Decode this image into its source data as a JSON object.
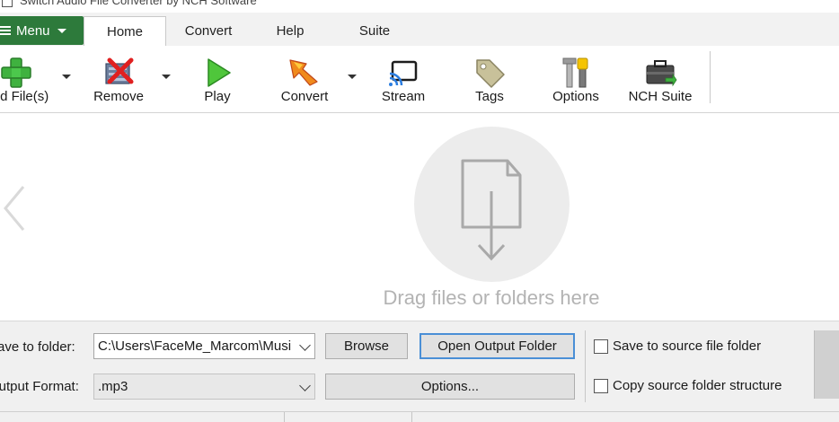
{
  "window": {
    "title": "Switch Audio File Converter by NCH Software"
  },
  "menu": {
    "label": "Menu"
  },
  "tabs": [
    {
      "label": "Home",
      "active": true
    },
    {
      "label": "Convert",
      "active": false
    },
    {
      "label": "Help",
      "active": false
    },
    {
      "label": "Suite",
      "active": false
    }
  ],
  "ribbon": {
    "add_files": "Add File(s)",
    "remove": "Remove",
    "play": "Play",
    "convert": "Convert",
    "stream": "Stream",
    "tags": "Tags",
    "options": "Options",
    "nch_suite": "NCH Suite"
  },
  "dropzone": {
    "text": "Drag files or folders here"
  },
  "output": {
    "save_to_folder_label": "Save to folder:",
    "folder_value": "C:\\Users\\FaceMe_Marcom\\Music",
    "browse": "Browse",
    "open_output_folder": "Open Output Folder",
    "output_format_label": "Output Format:",
    "format_value": ".mp3",
    "options": "Options...",
    "save_to_source": "Save to source file folder",
    "copy_structure": "Copy source folder structure"
  },
  "colors": {
    "menu_green": "#2d7a3b",
    "accent_blue": "#4a8fd6"
  }
}
